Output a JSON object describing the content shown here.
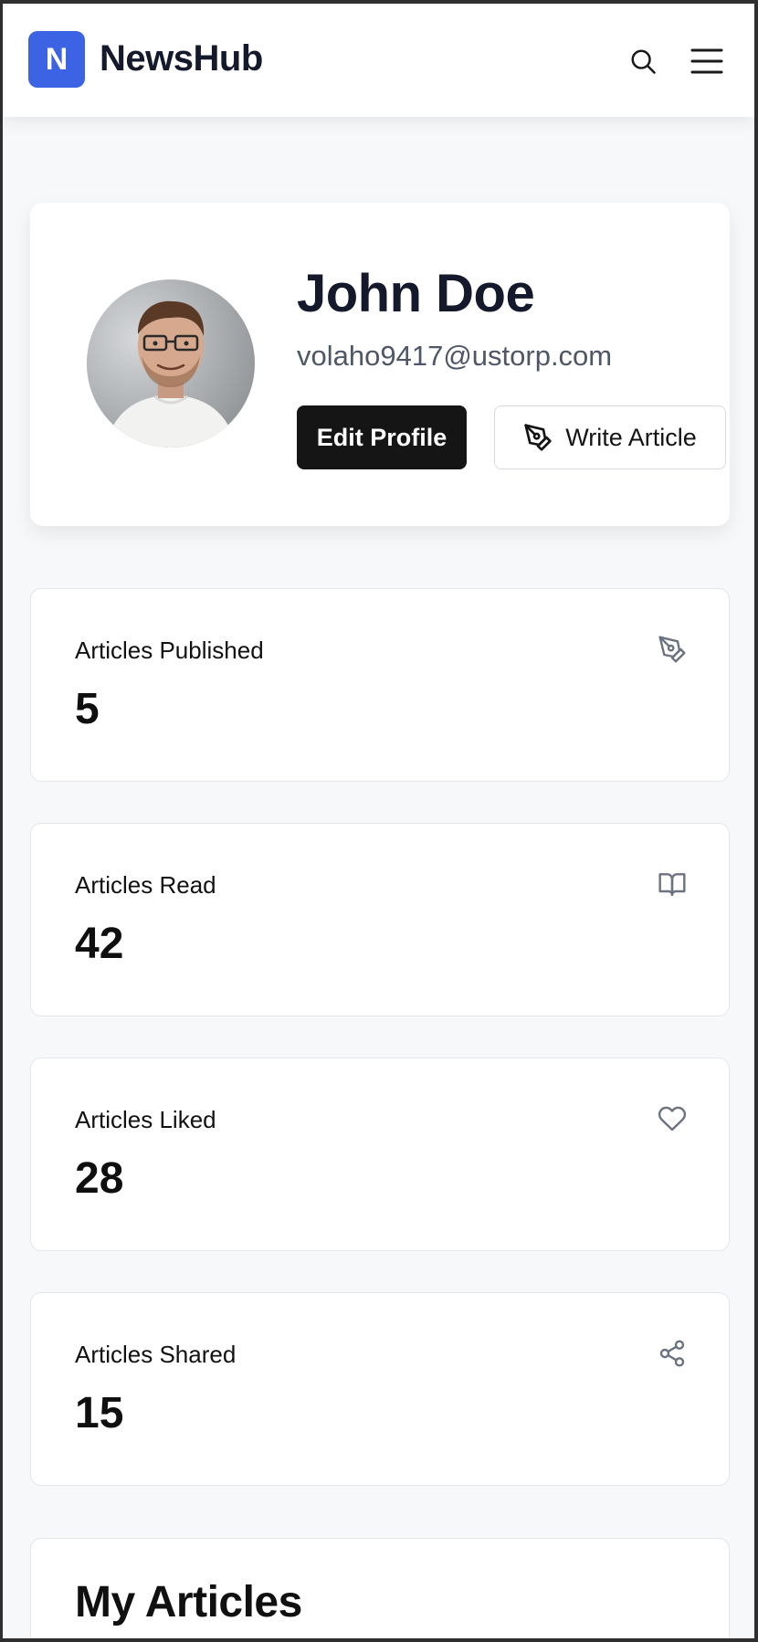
{
  "header": {
    "logo_letter": "N",
    "brand": "NewsHub",
    "search_icon": "search-icon",
    "menu_icon": "menu-icon"
  },
  "profile": {
    "name": "John Doe",
    "email": "volaho9417@ustorp.com",
    "edit_label": "Edit Profile",
    "write_label": "Write Article"
  },
  "stats": [
    {
      "label": "Articles Published",
      "value": "5",
      "icon": "pen-tool-icon"
    },
    {
      "label": "Articles Read",
      "value": "42",
      "icon": "book-open-icon"
    },
    {
      "label": "Articles Liked",
      "value": "28",
      "icon": "heart-icon"
    },
    {
      "label": "Articles Shared",
      "value": "15",
      "icon": "share-icon"
    }
  ],
  "articles": {
    "title": "My Articles"
  },
  "colors": {
    "accent": "#3b63e4",
    "primary_button": "#151515",
    "page_bg": "#f7f8fa"
  }
}
